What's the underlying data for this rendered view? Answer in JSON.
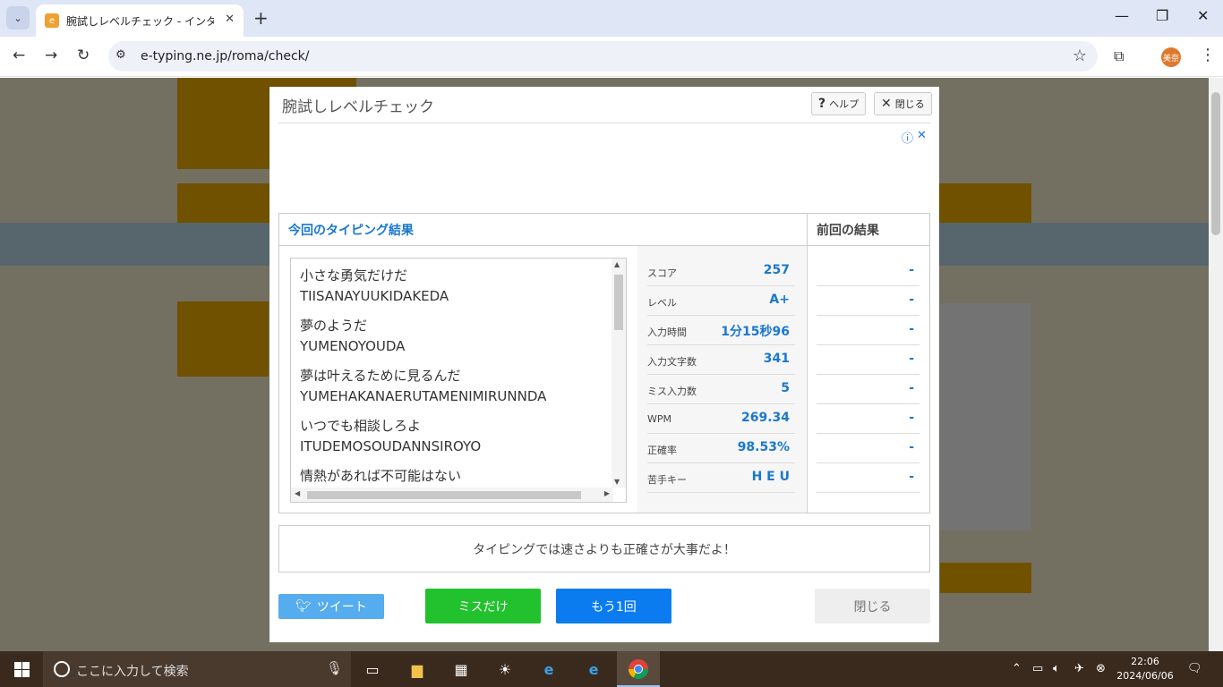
{
  "browser": {
    "tab_title": "腕試しレベルチェック - インターネット",
    "url": "e-typing.ne.jp/roma/check/",
    "profile_label": "美奈"
  },
  "modal": {
    "title": "腕試しレベルチェック",
    "help_label": "ヘルプ",
    "close_label": "閉じる",
    "results_heading": "今回のタイピング結果",
    "previous_heading": "前回の結果",
    "text_pairs": [
      {
        "jp": "小さな勇気だけだ",
        "ro": "TIISANAYUUKIDAKEDA"
      },
      {
        "jp": "夢のようだ",
        "ro": "YUMENOYOUDA"
      },
      {
        "jp": "夢は叶えるために見るんだ",
        "ro": "YUMEHAKANAERUTAMENIMIRUNNDA"
      },
      {
        "jp": "いつでも相談しろよ",
        "ro": "ITUDEMOSOUDANNSIROYO"
      },
      {
        "jp": "情熱があれば不可能はない",
        "ro": ""
      }
    ],
    "stats": [
      {
        "label": "スコア",
        "value": "257",
        "prev": "-"
      },
      {
        "label": "レベル",
        "value": "A+",
        "prev": "-"
      },
      {
        "label": "入力時間",
        "value": "1分15秒96",
        "prev": "-"
      },
      {
        "label": "入力文字数",
        "value": "341",
        "prev": "-"
      },
      {
        "label": "ミス入力数",
        "value": "5",
        "prev": "-"
      },
      {
        "label": "WPM",
        "value": "269.34",
        "prev": "-"
      },
      {
        "label": "正確率",
        "value": "98.53%",
        "prev": "-"
      },
      {
        "label": "苦手キー",
        "value": "H E U",
        "prev": "-"
      }
    ],
    "message": "タイピングでは速さよりも正確さが大事だよ！",
    "tweet_label": "ツイート",
    "miss_only_label": "ミスだけ",
    "again_label": "もう1回",
    "close_button_label": "閉じる"
  },
  "taskbar": {
    "search_placeholder": "ここに入力して検索",
    "time": "22:06",
    "date": "2024/06/06"
  }
}
